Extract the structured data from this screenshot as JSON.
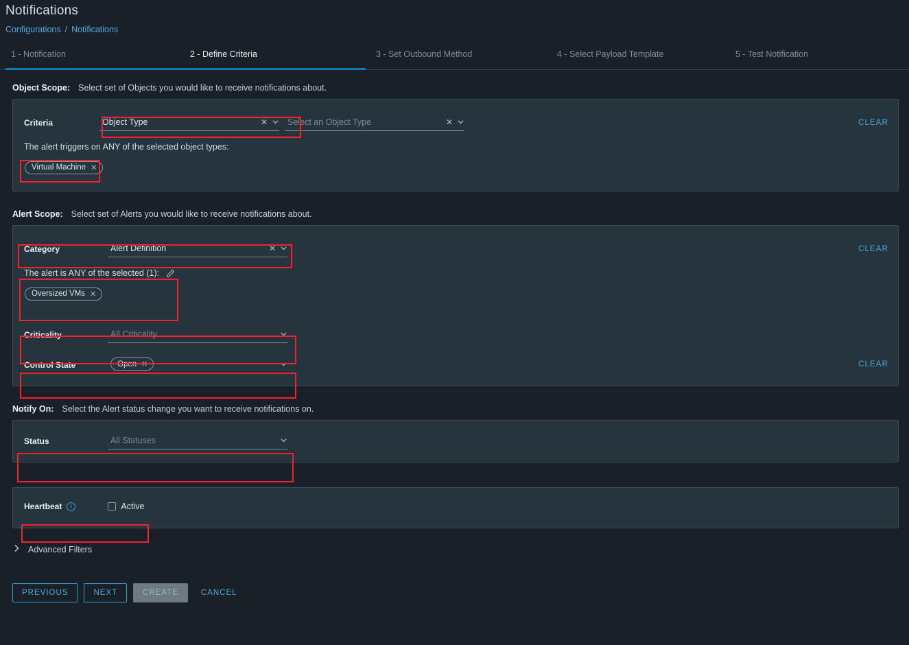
{
  "header": {
    "title": "Notifications",
    "breadcrumb": [
      {
        "label": "Configurations"
      },
      {
        "label": "/"
      },
      {
        "label": "Notifications"
      }
    ]
  },
  "tabs": [
    {
      "label": "1 - Notification",
      "active": false
    },
    {
      "label": "2 - Define Criteria",
      "active": true
    },
    {
      "label": "3 - Set Outbound Method",
      "active": false
    },
    {
      "label": "4 - Select Payload Template",
      "active": false
    },
    {
      "label": "5 - Test Notification",
      "active": false
    }
  ],
  "object_scope": {
    "label": "Object Scope:",
    "description": "Select set of Objects you would like to receive notifications about.",
    "criteria_label": "Criteria",
    "criteria_value": "Object Type",
    "object_type_placeholder": "Select an Object Type",
    "clear_label": "CLEAR",
    "hint": "The alert triggers on ANY of the selected object types:",
    "chips": [
      {
        "label": "Virtual Machine"
      }
    ]
  },
  "alert_scope": {
    "label": "Alert Scope:",
    "description": "Select set of Alerts you would like to receive notifications about.",
    "category_label": "Category",
    "category_value": "Alert Definition",
    "category_clear_label": "CLEAR",
    "selected_hint": "The alert is ANY of the selected (1):",
    "selected_chips": [
      {
        "label": "Oversized VMs"
      }
    ],
    "criticality_label": "Criticality",
    "criticality_value": "All Criticality",
    "control_state_label": "Control State",
    "control_state_chips": [
      {
        "label": "Open"
      }
    ],
    "control_state_clear_label": "CLEAR"
  },
  "notify_on": {
    "label": "Notify On:",
    "description": "Select the Alert status change you want to receive notifications on.",
    "status_label": "Status",
    "status_value": "All Statuses"
  },
  "heartbeat": {
    "label": "Heartbeat",
    "checkbox_label": "Active",
    "checked": false
  },
  "advanced_filters": {
    "label": "Advanced Filters",
    "expanded": false
  },
  "footer": {
    "previous": "PREVIOUS",
    "next": "NEXT",
    "create": "CREATE",
    "cancel": "CANCEL"
  },
  "colors": {
    "page_bg": "#192028",
    "panel_bg": "#26343d",
    "accent": "#4aabe0",
    "tab_underline": "#1279bd",
    "highlight": "#f5222d"
  }
}
